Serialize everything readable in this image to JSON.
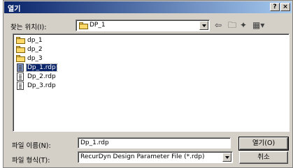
{
  "window": {
    "title": "열기",
    "help_button": "?",
    "close_button": "×"
  },
  "toolbar": {
    "look_in_label": "찾는 위치(I):",
    "look_in_value": "DP_1",
    "back_icon": "back-arrow-icon",
    "up_icon": "up-folder-icon",
    "new_folder_icon": "new-folder-icon",
    "view_icon": "view-menu-icon"
  },
  "files": {
    "items": [
      {
        "label": "dp_1",
        "type": "folder"
      },
      {
        "label": "dp_2",
        "type": "folder"
      },
      {
        "label": "dp_3",
        "type": "folder"
      },
      {
        "label": "Dp_1.rdp",
        "type": "file",
        "selected": true
      },
      {
        "label": "Dp_2.rdp",
        "type": "file"
      },
      {
        "label": "Dp_3.rdp",
        "type": "file"
      }
    ]
  },
  "form": {
    "filename_label": "파일 이름(N):",
    "filename_value": "Dp_1.rdp",
    "filetype_label": "파일 형식(T):",
    "filetype_value": "RecurDyn Design Parameter File (*.rdp)"
  },
  "buttons": {
    "open": "열기(O)",
    "cancel": "취소"
  },
  "colors": {
    "title_start": "#0a246a",
    "title_end": "#a6caf0",
    "face": "#d4d0c8",
    "selection": "#0a246a"
  }
}
